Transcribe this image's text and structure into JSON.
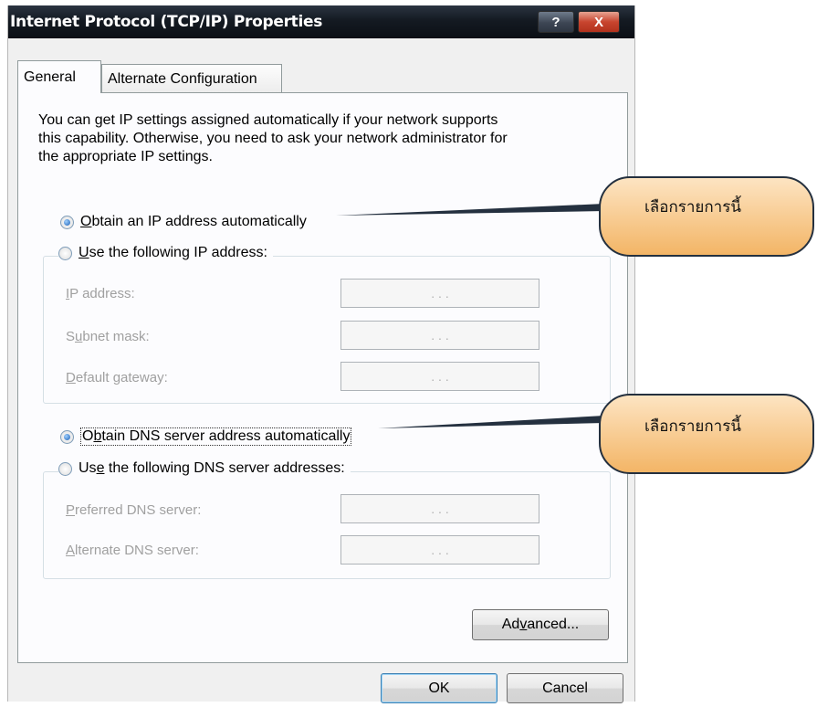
{
  "window": {
    "title": "Internet Protocol (TCP/IP) Properties",
    "help_label": "?",
    "close_label": "X"
  },
  "tabs": [
    {
      "label": "General",
      "selected": true
    },
    {
      "label": "Alternate Configuration",
      "selected": false
    }
  ],
  "description": "You can get IP settings assigned automatically if your network supports\nthis capability. Otherwise, you need to ask your network administrator for\nthe appropriate IP settings.",
  "ip": {
    "auto_option": {
      "prefix": "",
      "accel": "O",
      "rest": "btain an IP address automatically",
      "checked": true
    },
    "manual_option": {
      "prefix": "",
      "accel": "U",
      "rest": "se the following IP address:",
      "checked": false
    },
    "fields": [
      {
        "prefix": "",
        "accel": "I",
        "rest": "P address:",
        "value": ". . ."
      },
      {
        "prefix": "S",
        "accel": "u",
        "rest": "bnet mask:",
        "value": ". . ."
      },
      {
        "prefix": "",
        "accel": "D",
        "rest": "efault gateway:",
        "value": ". . ."
      }
    ]
  },
  "dns": {
    "auto_option": {
      "prefix": "O",
      "accel": "b",
      "rest": "tain DNS server address automatically",
      "checked": true
    },
    "manual_option": {
      "prefix": "Us",
      "accel": "e",
      "rest": " the following DNS server addresses:",
      "checked": false
    },
    "fields": [
      {
        "prefix": "",
        "accel": "P",
        "rest": "referred DNS server:",
        "value": ". . ."
      },
      {
        "prefix": "",
        "accel": "A",
        "rest": "lternate DNS server:",
        "value": ". . ."
      }
    ]
  },
  "buttons": {
    "advanced": {
      "prefix": "Ad",
      "accel": "v",
      "rest": "anced..."
    },
    "ok": "OK",
    "cancel": "Cancel"
  },
  "callouts": [
    {
      "text": "เลือกรายการนี้"
    },
    {
      "text": "เลือกรายการนี้"
    }
  ],
  "colors": {
    "callout_fill": "#f6c27e",
    "titlebar": "#141a22",
    "close_button": "#c8452f"
  }
}
